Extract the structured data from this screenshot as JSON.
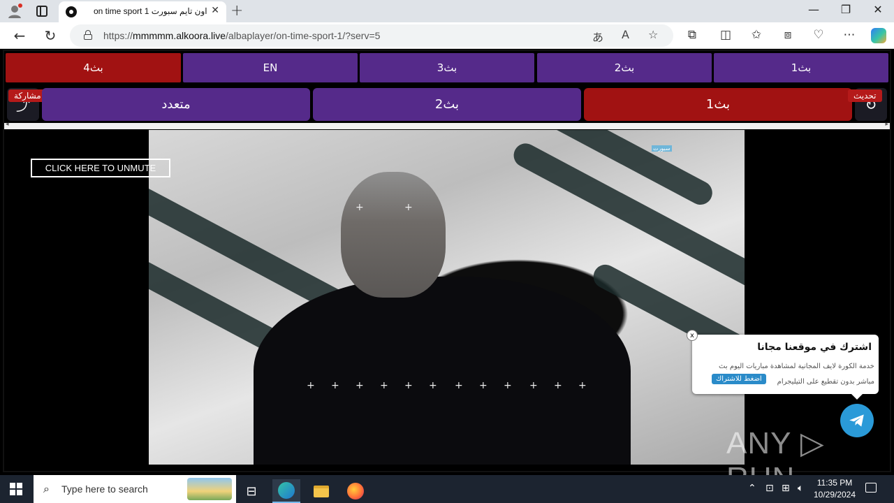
{
  "browser": {
    "tab_title": "on time sport 1 اون تايم سبورت",
    "tab_close": "✕",
    "new_tab": "+",
    "url_prefix": "https://",
    "url_host": "mmmmm.alkoora.live",
    "url_path": "/albaplayer/on-time-sport-1/?serv=5",
    "window_controls": {
      "minimize": "—",
      "maximize": "❐",
      "close": "✕"
    }
  },
  "servers_row": [
    {
      "label": "بث4",
      "state": "active"
    },
    {
      "label": "EN",
      "state": "normal"
    },
    {
      "label": "بث3",
      "state": "normal"
    },
    {
      "label": "بث2",
      "state": "normal"
    },
    {
      "label": "بث1",
      "state": "normal"
    }
  ],
  "quality_row": [
    {
      "label": "متعدد",
      "state": "normal"
    },
    {
      "label": "بث2",
      "state": "normal"
    },
    {
      "label": "بث1",
      "state": "active"
    }
  ],
  "share_label": "مشاركة",
  "refresh_label": "تحديث",
  "player": {
    "unmute_label": "CLICK HERE TO UNMUTE",
    "channel_tag": "ﺳﺒﻮﺭﺕ"
  },
  "popup": {
    "title": "اشترك في موقعنا مجانا",
    "line1": "خدمة الكورة لايف المجانية لمشاهدة مباريات اليوم بث",
    "line2": "مباشر بدون تقطيع على التيليجرام",
    "cta": "اضغط للاشتراك",
    "close": "x"
  },
  "watermark": "ANY ▷ RUN",
  "taskbar": {
    "search_placeholder": "Type here to search",
    "time": "11:35 PM",
    "date": "10/29/2024"
  },
  "colors": {
    "purple": "#552a8a",
    "red": "#a11212",
    "telegram": "#2a9ad8"
  }
}
